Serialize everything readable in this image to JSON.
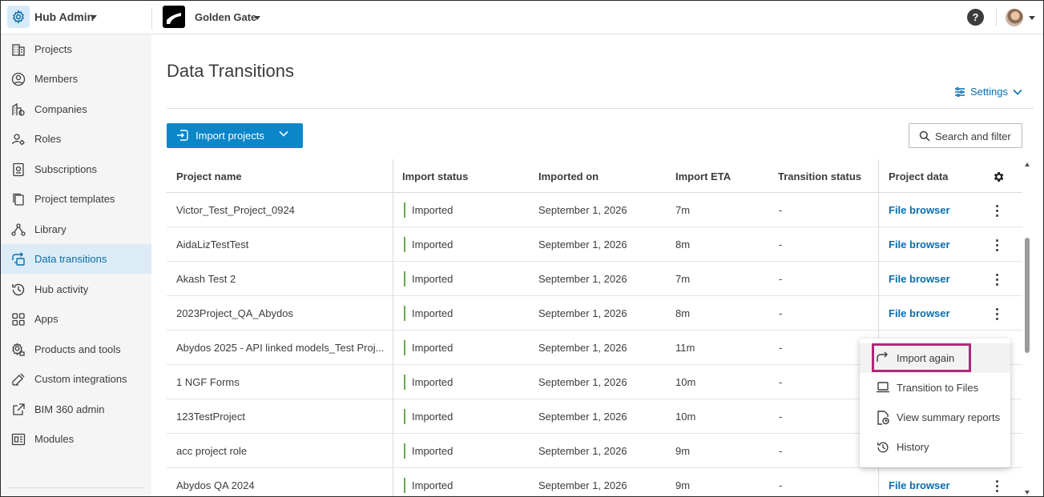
{
  "topbar": {
    "hub_name": "Hub Admin",
    "project_name": "Golden Gate",
    "help_label": "?"
  },
  "sidebar": {
    "items": [
      {
        "label": "Projects",
        "icon": "building-icon"
      },
      {
        "label": "Members",
        "icon": "user-circle-icon"
      },
      {
        "label": "Companies",
        "icon": "company-icon"
      },
      {
        "label": "Roles",
        "icon": "user-gear-icon"
      },
      {
        "label": "Subscriptions",
        "icon": "subscription-icon"
      },
      {
        "label": "Project templates",
        "icon": "templates-icon"
      },
      {
        "label": "Library",
        "icon": "library-icon"
      },
      {
        "label": "Data transitions",
        "icon": "data-transitions-icon"
      },
      {
        "label": "Hub activity",
        "icon": "history-icon"
      },
      {
        "label": "Apps",
        "icon": "apps-grid-icon"
      },
      {
        "label": "Products and tools",
        "icon": "gear-icon"
      },
      {
        "label": "Custom integrations",
        "icon": "integration-icon"
      },
      {
        "label": "BIM 360 admin",
        "icon": "external-link-icon"
      },
      {
        "label": "Modules",
        "icon": "modules-icon"
      }
    ],
    "active_index": 7
  },
  "main": {
    "title": "Data Transitions",
    "settings_label": "Settings",
    "import_label": "Import projects",
    "search_label": "Search and filter"
  },
  "table": {
    "headers": [
      "Project name",
      "Import status",
      "Imported on",
      "Import ETA",
      "Transition status",
      "Project data"
    ],
    "rows": [
      {
        "name": "Victor_Test_Project_0924",
        "status": "Imported",
        "date": "September 1, 2026",
        "eta": "7m",
        "transition": "-",
        "data": "File browser"
      },
      {
        "name": "AidaLizTestTest",
        "status": "Imported",
        "date": "September 1, 2026",
        "eta": "8m",
        "transition": "-",
        "data": "File browser"
      },
      {
        "name": "Akash Test 2",
        "status": "Imported",
        "date": "September 1, 2026",
        "eta": "7m",
        "transition": "-",
        "data": "File browser"
      },
      {
        "name": "2023Project_QA_Abydos",
        "status": "Imported",
        "date": "September 1, 2026",
        "eta": "8m",
        "transition": "-",
        "data": "File browser"
      },
      {
        "name": "Abydos 2025 - API linked models_Test Proj...",
        "status": "Imported",
        "date": "September 1, 2026",
        "eta": "11m",
        "transition": "-",
        "data": ""
      },
      {
        "name": "1 NGF Forms",
        "status": "Imported",
        "date": "September 1, 2026",
        "eta": "10m",
        "transition": "-",
        "data": ""
      },
      {
        "name": "123TestProject",
        "status": "Imported",
        "date": "September 1, 2026",
        "eta": "10m",
        "transition": "-",
        "data": ""
      },
      {
        "name": "acc project role",
        "status": "Imported",
        "date": "September 1, 2026",
        "eta": "9m",
        "transition": "-",
        "data": ""
      },
      {
        "name": "Abydos QA 2024",
        "status": "Imported",
        "date": "September 1, 2026",
        "eta": "9m",
        "transition": "-",
        "data": "File browser"
      }
    ]
  },
  "menu": {
    "items": [
      {
        "label": "Import again",
        "icon": "redo-arrow-icon"
      },
      {
        "label": "Transition to Files",
        "icon": "laptop-icon"
      },
      {
        "label": "View summary reports",
        "icon": "report-icon"
      },
      {
        "label": "History",
        "icon": "history-icon"
      }
    ]
  },
  "colors": {
    "accent": "#0a86c9",
    "link": "#0a6dad",
    "status_imported": "#6aa84f",
    "highlight_box": "#b0287a",
    "sidebar_bg": "#f5f5f5",
    "active_bg": "#dcecf7"
  }
}
